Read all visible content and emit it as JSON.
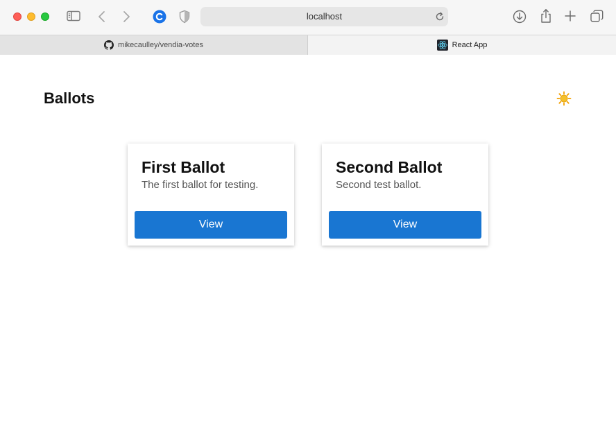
{
  "browser": {
    "address": "localhost",
    "tabs": [
      {
        "label": "mikecaulley/vendia-votes",
        "icon": "github-icon",
        "active": false
      },
      {
        "label": "React App",
        "icon": "react-icon",
        "active": true
      }
    ],
    "colors": {
      "close": "#fe5f57",
      "minimize": "#febc2e",
      "zoom": "#28c840",
      "extension": "#1a73e8"
    }
  },
  "page": {
    "title": "Ballots",
    "theme_toggle_icon": "sun-icon",
    "accent": "#1976d2",
    "ballots": [
      {
        "title": "First Ballot",
        "description": "The first ballot for testing.",
        "button_label": "View"
      },
      {
        "title": "Second Ballot",
        "description": "Second test ballot.",
        "button_label": "View"
      }
    ]
  }
}
